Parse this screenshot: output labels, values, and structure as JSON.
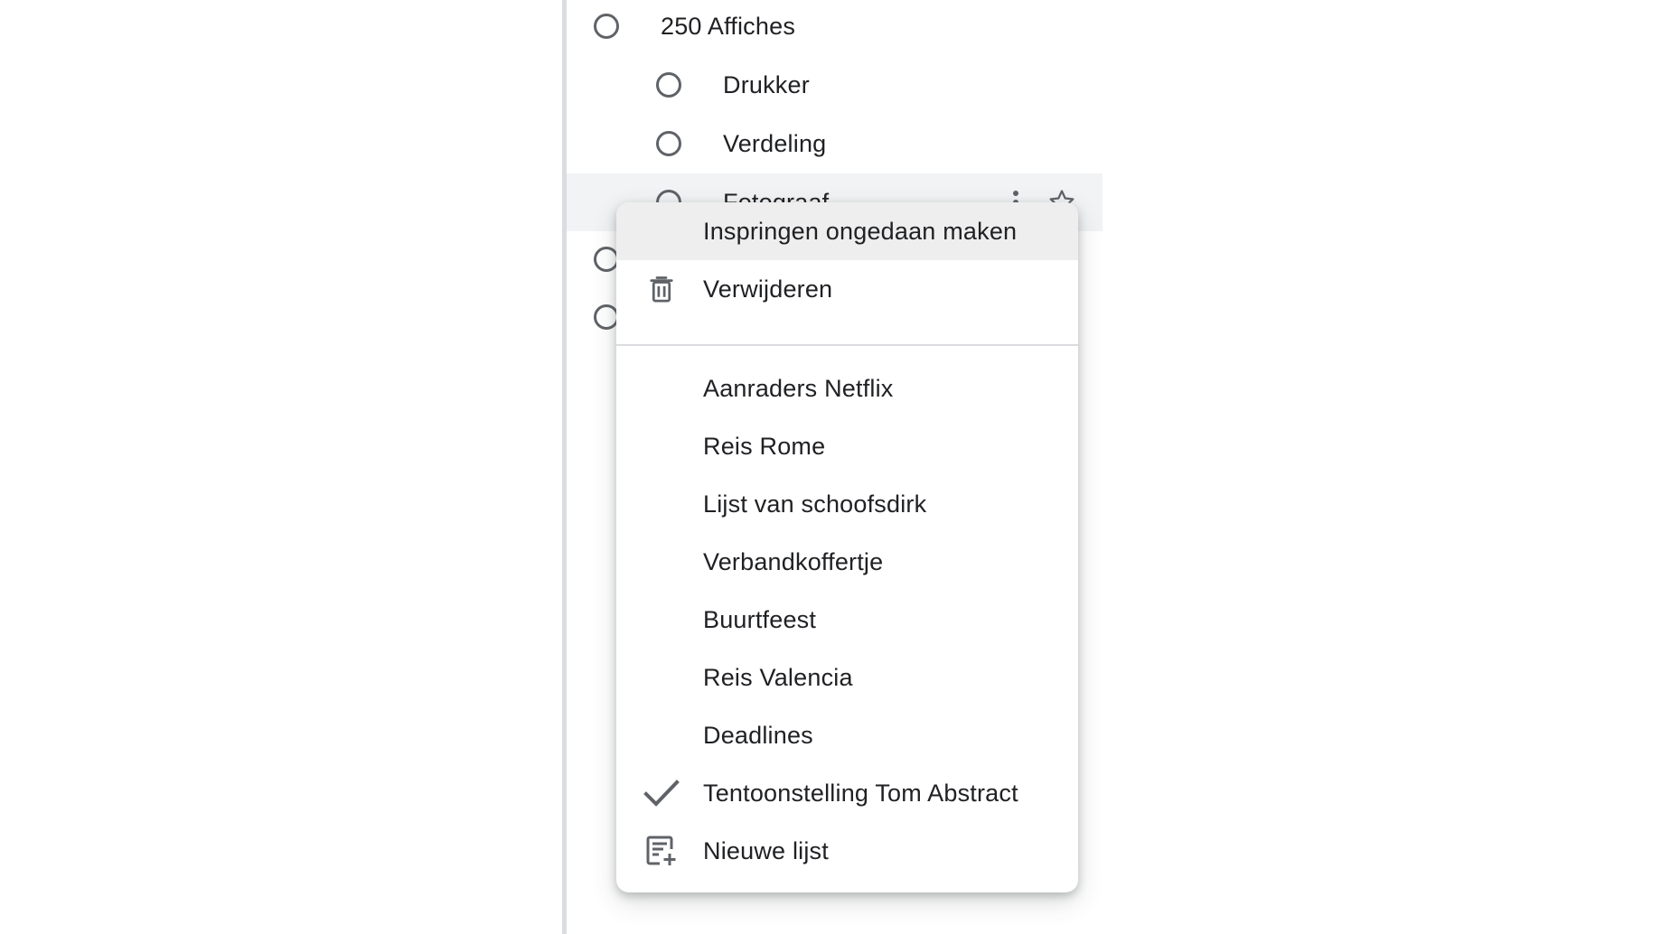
{
  "tasks": [
    {
      "label": "250 Affiches"
    },
    {
      "label": "Drukker"
    },
    {
      "label": "Verdeling"
    },
    {
      "label": "Fotograaf"
    }
  ],
  "menu": {
    "indent_label": "Inspringen ongedaan maken",
    "delete_label": "Verwijderen",
    "lists": [
      {
        "label": "Aanraders Netflix",
        "selected": false
      },
      {
        "label": "Reis Rome",
        "selected": false
      },
      {
        "label": "Lijst van schoofsdirk",
        "selected": false
      },
      {
        "label": "Verbandkoffertje",
        "selected": false
      },
      {
        "label": "Buurtfeest",
        "selected": false
      },
      {
        "label": "Reis Valencia",
        "selected": false
      },
      {
        "label": "Deadlines",
        "selected": false
      },
      {
        "label": "Tentoonstelling Tom Abstract",
        "selected": true
      }
    ],
    "new_list_label": "Nieuwe lijst"
  },
  "icons": {
    "radio": "radio-unchecked-icon",
    "more": "more-vert-icon",
    "star": "star-outline-icon",
    "delete": "trash-icon",
    "check": "check-icon",
    "new_list": "playlist-add-icon"
  },
  "colors": {
    "icon_gray": "#5f6368",
    "text": "#202124",
    "highlight_row": "#f1f3f4",
    "active_menu_item": "#eeeeee",
    "divider": "#dadce0"
  }
}
